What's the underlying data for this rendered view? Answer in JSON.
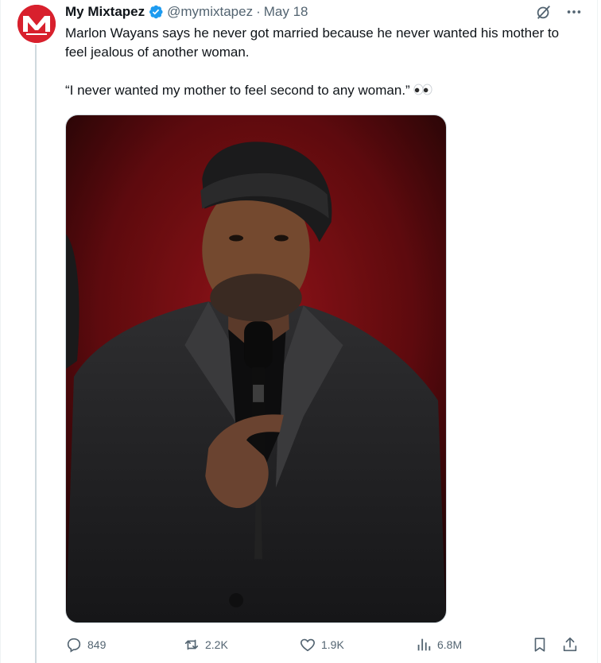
{
  "tweet": {
    "author_name": "My Mixtapez",
    "handle": "@mymixtapez",
    "separator": "·",
    "date": "May 18",
    "line1": "Marlon Wayans says he never got married because he never wanted his mother to feel jealous of another woman.",
    "line2": "“I never wanted my mother to feel second to any woman.”"
  },
  "avatar": {
    "logo_text": "MM",
    "color": "#d8202d"
  },
  "actions": {
    "replies": "849",
    "retweets": "2.2K",
    "likes": "1.9K",
    "views": "6.8M"
  },
  "icons": {
    "verified": "verified-badge-icon",
    "grok": "grok-icon",
    "more": "more-icon",
    "reply": "reply-icon",
    "retweet": "retweet-icon",
    "like": "heart-icon",
    "views": "views-chart-icon",
    "bookmark": "bookmark-icon",
    "share": "share-icon"
  },
  "colors": {
    "accent": "#1d9bf0",
    "secondary_text": "#536471"
  }
}
